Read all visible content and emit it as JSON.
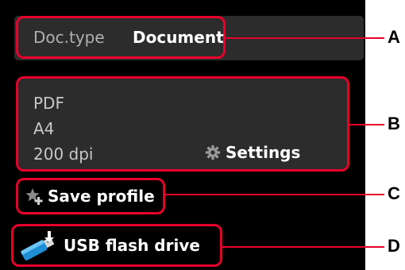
{
  "doc_type": {
    "label": "Doc.type",
    "value": "Document"
  },
  "scan_settings": {
    "format": "PDF",
    "size": "A4",
    "resolution": "200 dpi",
    "settings_label": "Settings"
  },
  "save_profile": {
    "label": "Save profile"
  },
  "destination": {
    "label": "USB flash drive"
  },
  "callouts": [
    "A",
    "B",
    "C",
    "D"
  ],
  "colors": {
    "screen": "#000000",
    "panel": "#2c2c2c",
    "highlight": "#e8002a"
  },
  "icons": [
    "gear-icon",
    "plus-star-icon",
    "usb-flash-drive-icon"
  ]
}
